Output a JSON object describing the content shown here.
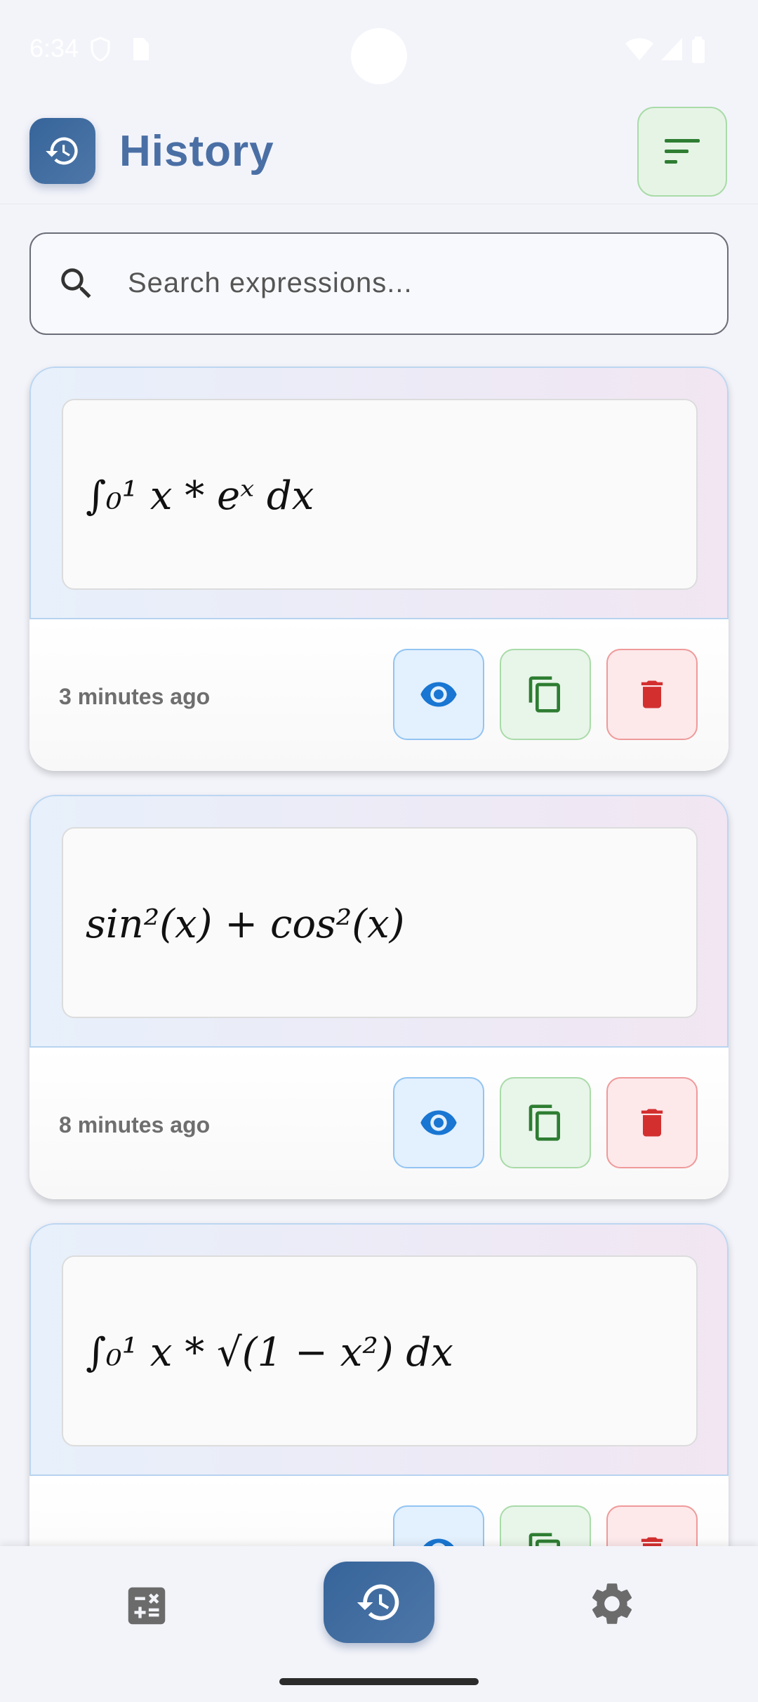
{
  "status_bar": {
    "time": "6:34"
  },
  "header": {
    "title": "History"
  },
  "search": {
    "placeholder": "Search expressions..."
  },
  "history_items": [
    {
      "expression": "∫₀¹ x * eˣ dx",
      "time_ago": "3 minutes ago"
    },
    {
      "expression": "sin²(x) + cos²(x)",
      "time_ago": "8 minutes ago"
    },
    {
      "expression": "∫₀¹ x * √(1 − x²) dx",
      "time_ago": ""
    }
  ],
  "icons": {
    "header_logo": "history-icon",
    "filter": "sort-icon",
    "search": "search-icon",
    "view": "eye-icon",
    "copy": "copy-icon",
    "delete": "trash-icon",
    "nav_calculator": "calculator-icon",
    "nav_history": "history-icon",
    "nav_settings": "gear-icon"
  },
  "colors": {
    "primary": "#3B6A9F",
    "view_accent": "#1976D2",
    "copy_accent": "#2E7D32",
    "delete_accent": "#D32F2F"
  }
}
